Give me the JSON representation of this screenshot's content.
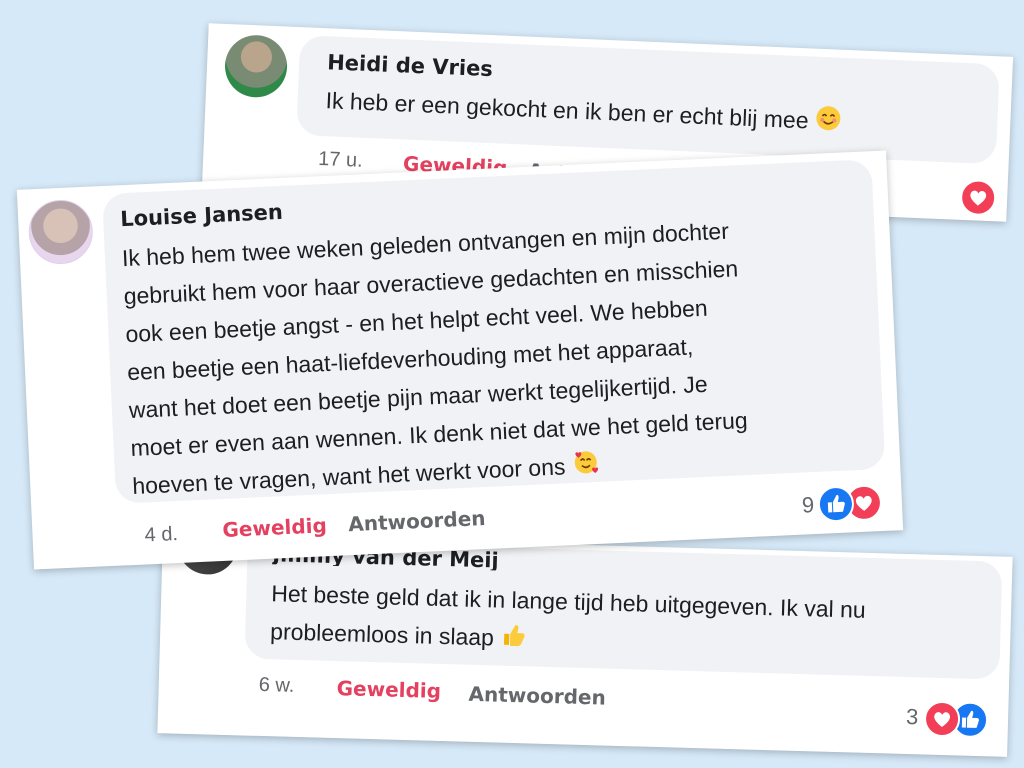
{
  "comments": [
    {
      "name": "Heidi de Vries",
      "text": "Ik heb er een gekocht en ik ben er echt blij mee",
      "emoji": "smiling-face-icon",
      "time": "17 u.",
      "like_label": "Geweldig",
      "reply_label": "Antwoorden",
      "reactions": [
        "heart"
      ]
    },
    {
      "name": "Louise Jansen",
      "text_lines": [
        "Ik heb hem twee weken geleden ontvangen en mijn dochter",
        "gebruikt hem voor haar overactieve gedachten en misschien",
        "ook een beetje angst - en het helpt echt veel. We hebben",
        "een beetje een haat-liefdeverhouding met het apparaat,",
        "want het doet een beetje pijn maar werkt tegelijkertijd. Je",
        "moet er even aan wennen. Ik denk niet dat we het geld terug",
        "hoeven te vragen, want het werkt voor ons"
      ],
      "emoji": "smiling-face-with-hearts-icon",
      "time": "4 d.",
      "like_label": "Geweldig",
      "reply_label": "Antwoorden",
      "reaction_count": "9",
      "reactions": [
        "like",
        "heart"
      ]
    },
    {
      "name": "Jimmy van der Meij",
      "text_lines": [
        "Het beste geld dat ik in lange tijd heb uitgegeven. Ik val nu",
        "probleemloos in slaap"
      ],
      "emoji": "thumbs-up-icon",
      "time": "6 w.",
      "like_label": "Geweldig",
      "reply_label": "Antwoorden",
      "reaction_count": "3",
      "reactions": [
        "heart",
        "like"
      ]
    }
  ],
  "colors": {
    "background": "#d6e9f8",
    "bubble": "#f0f2f5",
    "like_text": "#e4405f",
    "like_blue": "#1877f2",
    "heart_red": "#f33e58"
  }
}
